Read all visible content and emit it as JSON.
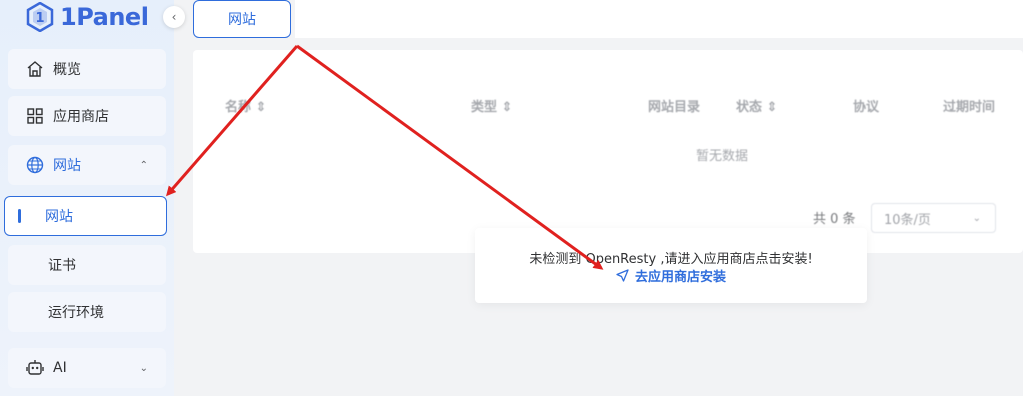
{
  "brand": {
    "name": "1Panel"
  },
  "sidebar": {
    "items": [
      {
        "label": "概览",
        "icon": "home-icon"
      },
      {
        "label": "应用商店",
        "icon": "grid-icon"
      },
      {
        "label": "网站",
        "icon": "globe-icon",
        "expanded": true
      },
      {
        "label": "AI",
        "icon": "robot-icon"
      }
    ],
    "subitems": [
      {
        "label": "网站",
        "active": true
      },
      {
        "label": "证书"
      },
      {
        "label": "运行环境"
      }
    ]
  },
  "top_tab": {
    "label": "网站"
  },
  "table": {
    "columns": [
      "名称",
      "类型",
      "网站目录",
      "状态",
      "协议",
      "过期时间"
    ],
    "empty_text": "暂无数据",
    "total_text": "共 0 条",
    "page_size": "10条/页"
  },
  "notice": {
    "message": "未检测到 OpenResty ,请进入应用商店点击安装!",
    "link": "去应用商店安装"
  },
  "colors": {
    "accent": "#2f6ddc",
    "annotation_arrow": "#e0211f"
  }
}
